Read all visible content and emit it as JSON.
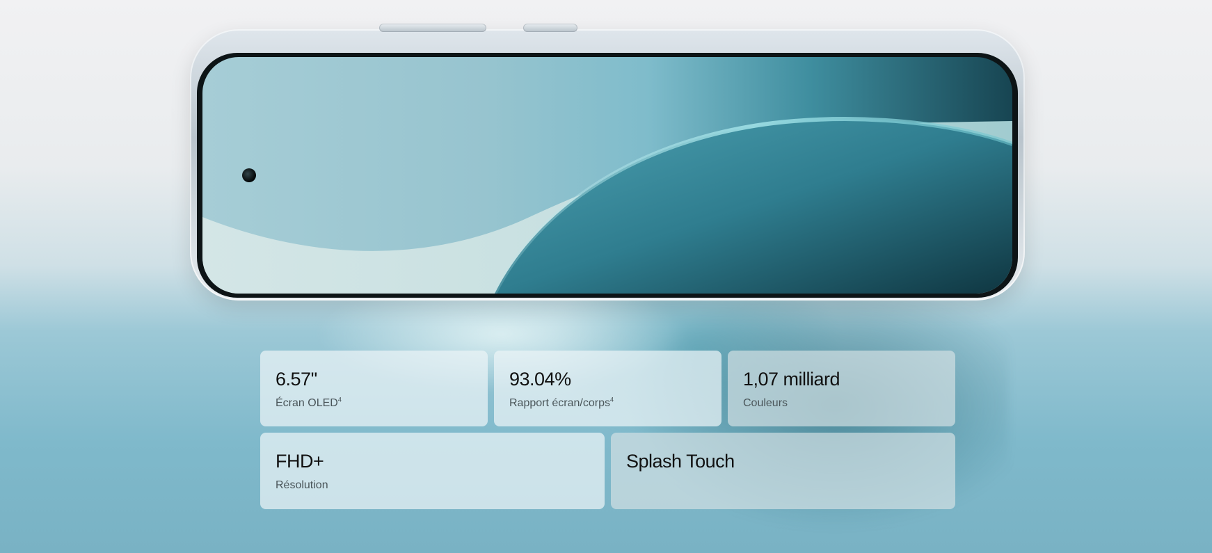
{
  "specs": [
    {
      "value": "6.57''",
      "label": "Écran OLED",
      "sup": "4"
    },
    {
      "value": "93.04%",
      "label": "Rapport écran/corps",
      "sup": "4"
    },
    {
      "value": "1,07 milliard",
      "label": "Couleurs"
    },
    {
      "value": "FHD+",
      "label": "Résolution"
    },
    {
      "value": "Splash Touch"
    }
  ],
  "colors": {
    "background_top": "#f1f1f3",
    "background_bottom": "#79b2c4",
    "screen_teal": "#3f8e9f",
    "text": "#111111"
  }
}
